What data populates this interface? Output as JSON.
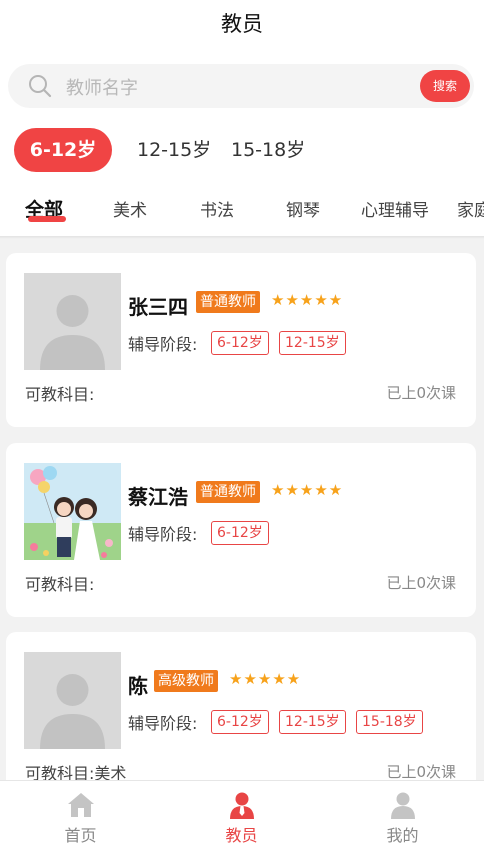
{
  "header": {
    "title": "教员"
  },
  "search": {
    "placeholder": "教师名字",
    "button_label": "搜索"
  },
  "age_filters": [
    {
      "label": "6-12岁",
      "active": true
    },
    {
      "label": "12-15岁",
      "active": false
    },
    {
      "label": "15-18岁",
      "active": false
    }
  ],
  "categories": [
    {
      "label": "全部",
      "active": true
    },
    {
      "label": "美术"
    },
    {
      "label": "书法"
    },
    {
      "label": "钢琴"
    },
    {
      "label": "心理辅导"
    },
    {
      "label": "家庭教育"
    }
  ],
  "teachers": [
    {
      "name": "张三四",
      "level": "普通教师",
      "rating": 5,
      "stars": "★★★★★",
      "stage_label": "辅导阶段:",
      "stages": [
        "6-12岁",
        "12-15岁"
      ],
      "subjects_label": "可教科目:",
      "subjects": "",
      "lessons": "已上0次课",
      "avatar": "default-avatar"
    },
    {
      "name": "蔡江浩",
      "level": "普通教师",
      "rating": 5,
      "stars": "★★★★★",
      "stage_label": "辅导阶段:",
      "stages": [
        "6-12岁"
      ],
      "subjects_label": "可教科目:",
      "subjects": "",
      "lessons": "已上0次课",
      "avatar": "couple-photo"
    },
    {
      "name": "陈",
      "level": "高级教师",
      "rating": 5,
      "stars": "★★★★★",
      "stage_label": "辅导阶段:",
      "stages": [
        "6-12岁",
        "12-15岁",
        "15-18岁"
      ],
      "subjects_label": "可教科目:",
      "subjects": "美术",
      "lessons": "已上0次课",
      "avatar": "default-avatar"
    }
  ],
  "tabbar": [
    {
      "label": "首页",
      "icon": "home-icon",
      "active": false
    },
    {
      "label": "教员",
      "icon": "teacher-icon",
      "active": true
    },
    {
      "label": "我的",
      "icon": "profile-icon",
      "active": false
    }
  ],
  "colors": {
    "accent": "#f04444",
    "badge": "#f07a1c",
    "star": "#f7a21b"
  }
}
